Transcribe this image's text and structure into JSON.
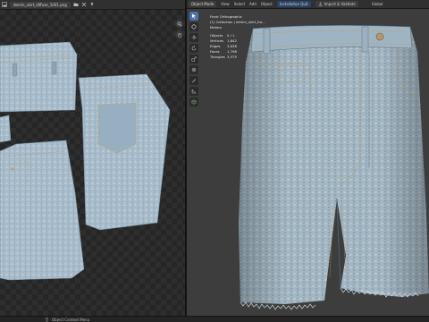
{
  "image_editor": {
    "image_name": "denim_skirt_diffuse_1001.png",
    "icons": [
      "image-icon",
      "folder-icon",
      "close-icon",
      "pin-icon",
      "zoom-icon",
      "hand-icon"
    ]
  },
  "viewport_header": {
    "mode": "Object Mode",
    "menus": [
      "View",
      "Select",
      "Add",
      "Object"
    ],
    "buttons": [
      {
        "label": "Installation Quit",
        "accent": true
      },
      {
        "label": "Import & Validate",
        "accent": false
      }
    ],
    "transform": "Global"
  },
  "viewport_overlay": {
    "view_name": "Front Orthographic",
    "collection": "(1) Collection | denim_skirt_fro...",
    "units": "Meters",
    "stats": [
      {
        "label": "Objects",
        "value": "0 / 1"
      },
      {
        "label": "Vertices",
        "value": "1,842"
      },
      {
        "label": "Edges",
        "value": "3,638"
      },
      {
        "label": "Faces",
        "value": "1,798"
      },
      {
        "label": "Triangles",
        "value": "3,575"
      }
    ]
  },
  "tools": [
    "cursor-tool-icon",
    "select-circle-icon",
    "move-icon",
    "rotate-icon",
    "scale-icon",
    "transform-icon",
    "annotate-icon",
    "measure-icon",
    "add-cube-icon"
  ],
  "status_bar": {
    "text": "Object Context Menu"
  },
  "colors": {
    "denim_light": "#a9bdca",
    "denim_mid": "#8fa6b6",
    "denim_dark": "#5f7485",
    "accent": "#4772b3"
  }
}
